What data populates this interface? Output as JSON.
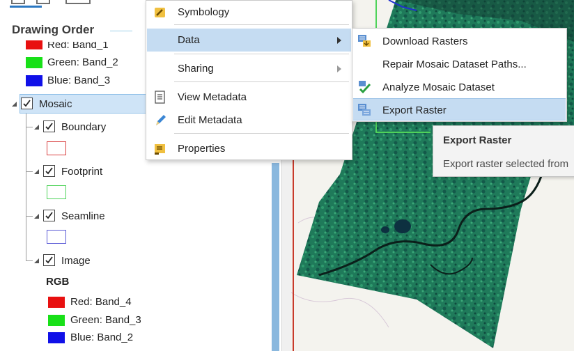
{
  "contents": {
    "heading": "Drawing Order",
    "top_bands": [
      {
        "label": "Red:   Band_1",
        "color": "#e81010"
      },
      {
        "label": "Green:  Band_2",
        "color": "#18e018"
      },
      {
        "label": "Blue:  Band_3",
        "color": "#1010e8"
      }
    ],
    "mosaic_label": "Mosaic",
    "sublayers": [
      {
        "label": "Boundary",
        "symbol_color": "#d94040"
      },
      {
        "label": "Footprint",
        "symbol_color": "#4fd35a"
      },
      {
        "label": "Seamline",
        "symbol_color": "#5a5ad6"
      },
      {
        "label": "Image"
      }
    ],
    "rgb_heading": "RGB",
    "image_bands": [
      {
        "label": "Red:   Band_4",
        "color": "#e81010"
      },
      {
        "label": "Green: Band_3",
        "color": "#18e018"
      },
      {
        "label": "Blue:  Band_2",
        "color": "#1010e8"
      }
    ]
  },
  "context_menu": {
    "items": [
      {
        "label": "Symbology",
        "icon": "symbology-icon"
      },
      {
        "label": "Data",
        "icon": "",
        "submenu": true,
        "highlighted": true
      },
      {
        "label": "Sharing",
        "icon": "",
        "submenu": true
      },
      {
        "label": "View Metadata",
        "icon": "view-metadata-icon"
      },
      {
        "label": "Edit Metadata",
        "icon": "edit-metadata-icon"
      },
      {
        "label": "Properties",
        "icon": "properties-icon"
      }
    ]
  },
  "sub_menu": {
    "items": [
      {
        "label": "Download Rasters",
        "icon": "download-rasters-icon"
      },
      {
        "label": "Repair Mosaic Dataset Paths...",
        "icon": ""
      },
      {
        "label": "Analyze Mosaic Dataset",
        "icon": "analyze-mosaic-icon"
      },
      {
        "label": "Export Raster",
        "icon": "export-raster-icon",
        "highlighted": true
      }
    ]
  },
  "tooltip": {
    "title": "Export Raster",
    "body": "Export raster selected from"
  },
  "colors": {
    "accent": "#2b78c2",
    "highlight": "#c5dcf2",
    "raster_green": "#1f7a5a",
    "raster_dark": "#123a30"
  }
}
